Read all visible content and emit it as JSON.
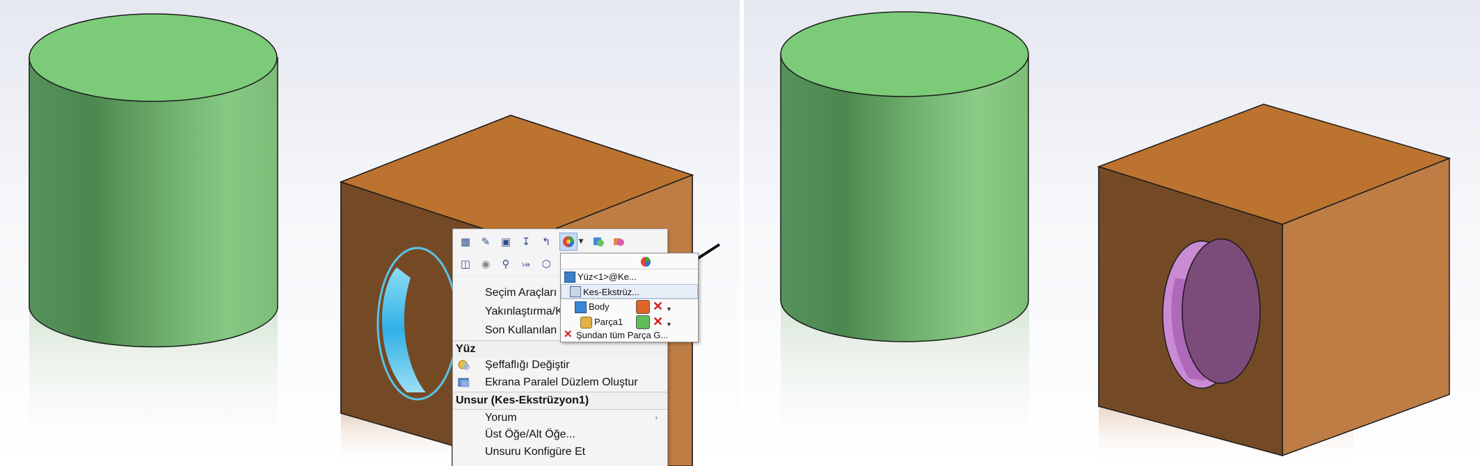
{
  "colors": {
    "cylinder_top": "#7ccb79",
    "cylinder_side_dark": "#4f8a50",
    "cylinder_side_light": "#8ccd88",
    "box_top": "#bc7330",
    "box_front": "#744a26",
    "box_right": "#bd7d44",
    "hole_highlight": "#3fc6f5",
    "hole_purple": "#7b4b7a",
    "hole_pink": "#c98bd3"
  },
  "toolbar": {
    "row1_icons": [
      "edit-sketch-icon",
      "edit-feature-icon",
      "sketch-icon",
      "rollback-icon",
      "undo-arrow-icon",
      "appearance-icon",
      "dropdown-arrow-icon",
      "appearances-panel-icon",
      "display-pane-icon"
    ],
    "row2_icons": [
      "normal-to-icon",
      "hide-icon",
      "zoom-to-selection-icon",
      "coordinate-icon",
      "isometric-icon"
    ]
  },
  "menu": {
    "items_top": [
      {
        "label": "Seçim Araçları"
      },
      {
        "label": "Yakınlaştırma/Ka"
      },
      {
        "label": "Son Kullanılan K"
      }
    ],
    "section_face": "Yüz",
    "face_items": [
      {
        "label": "Şeffaflığı Değiştir",
        "icon": "transparency-icon"
      },
      {
        "label": "Ekrana Paralel Düzlem Oluştur",
        "icon": "parallel-plane-icon"
      }
    ],
    "section_feature": "Unsur (Kes-Ekstrüzyon1)",
    "feature_items": [
      {
        "label": "Yorum",
        "submenu": "›"
      },
      {
        "label": "Üst Öğe/Alt Öğe..."
      },
      {
        "label": "Unsuru Konfigüre Et"
      }
    ]
  },
  "flyout": {
    "header_icon": "color-wheel-icon",
    "rows": [
      {
        "label": "Yüz<1>@Ke..."
      },
      {
        "label": "Kes-Ekstrüz..."
      },
      {
        "label": "Body"
      },
      {
        "label": "Parça1"
      },
      {
        "label": "Şundan tüm Parça G..."
      }
    ]
  }
}
